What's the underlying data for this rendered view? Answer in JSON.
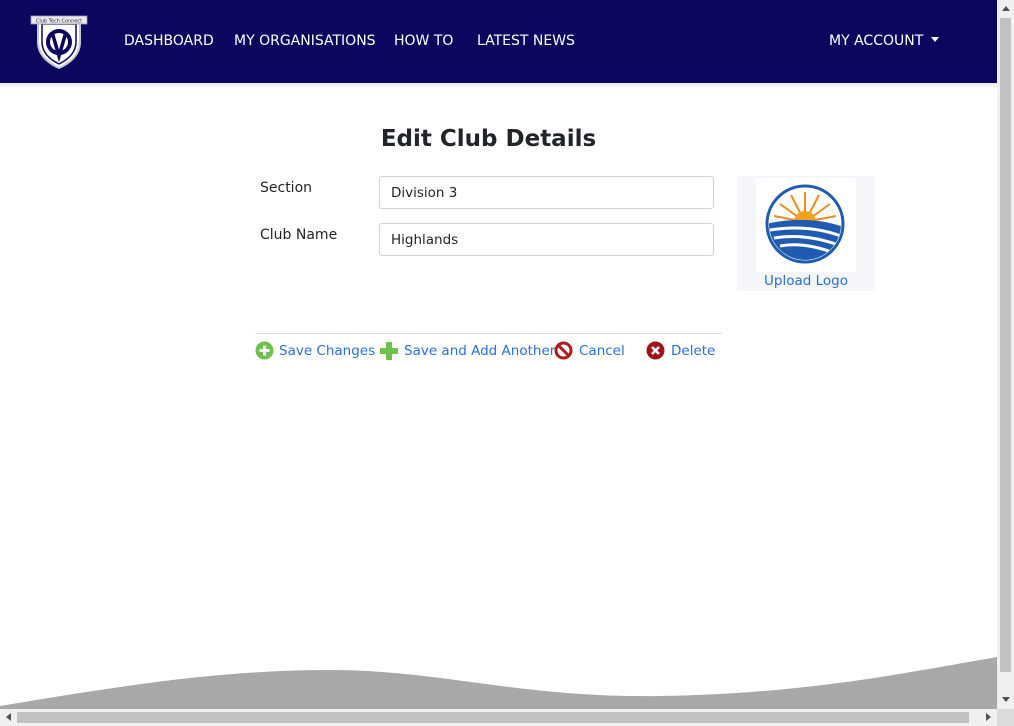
{
  "nav": {
    "logo_banner": "Club Tech Connect",
    "items": [
      {
        "label": "DASHBOARD"
      },
      {
        "label": "MY ORGANISATIONS"
      },
      {
        "label": "HOW TO"
      },
      {
        "label": "LATEST NEWS"
      }
    ],
    "account_label": "MY ACCOUNT"
  },
  "page": {
    "title": "Edit Club Details"
  },
  "form": {
    "section": {
      "label": "Section",
      "value": "Division 3"
    },
    "club_name": {
      "label": "Club Name",
      "value": "Highlands"
    }
  },
  "logo_panel": {
    "upload_label": "Upload Logo"
  },
  "actions": {
    "save": "Save Changes",
    "save_add": "Save and Add Another",
    "cancel": "Cancel",
    "delete": "Delete"
  },
  "colors": {
    "navbar": "#0b075e",
    "link": "#2b6fd6",
    "save_icon": "#6cc24a",
    "cancel_icon": "#b01c1c",
    "delete_icon": "#a0151d",
    "footer_wave": "#a8a8a8"
  },
  "icons": {
    "logo": "crest-logo-icon",
    "save": "plus-circle-icon",
    "save_add": "plus-icon",
    "cancel": "prohibited-icon",
    "delete": "x-circle-icon",
    "account": "caret-down-icon"
  }
}
